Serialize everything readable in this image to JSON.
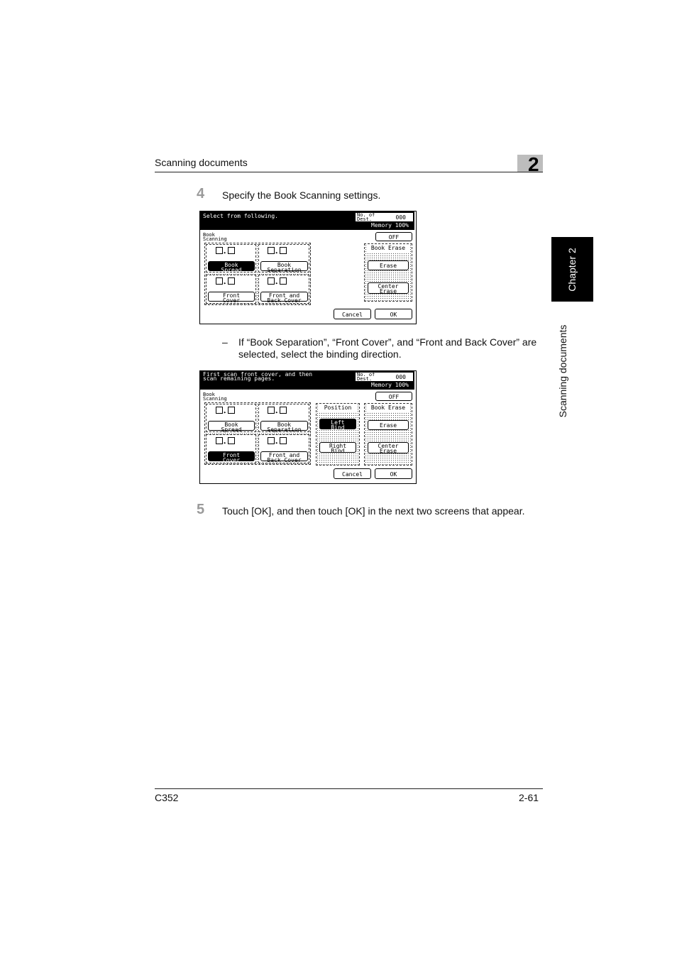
{
  "header": {
    "title": "Scanning documents",
    "chapter_number": "2"
  },
  "side_tab": {
    "chapter": "Chapter 2",
    "section": "Scanning documents"
  },
  "steps": [
    {
      "number": "4",
      "text": "Specify the Book Scanning settings."
    },
    {
      "number": "5",
      "text": "Touch [OK], and then touch [OK] in the next two screens that appear."
    }
  ],
  "substep": {
    "dash": "–",
    "text": "If “Book Separation”, “Front Cover”, and “Front and Back Cover” are selected, select the binding direction."
  },
  "screen1": {
    "message": "Select from following.",
    "dest_label": "No. of\nDest.",
    "dest_value": "000",
    "memory": "Memory 100%",
    "book_scanning_label": "Book\nScanning",
    "options": {
      "book_spread": "Book\nSpread",
      "book_separation": "Book\nSeparation",
      "front_cover": "Front\nCover",
      "front_back_cover": "Front and\nBack Cover"
    },
    "off": "OFF",
    "book_erase_title": "Book Erase",
    "erase": "Erase",
    "center_erase": "Center\nErase",
    "cancel": "Cancel",
    "ok": "OK"
  },
  "screen2": {
    "message": "First scan front cover, and then\nscan remaining pages.",
    "dest_label": "No. of\nDest.",
    "dest_value": "000",
    "memory": "Memory 100%",
    "book_scanning_label": "Book\nScanning",
    "options": {
      "book_spread": "Book\nSpread",
      "book_separation": "Book\nSeparation",
      "front_cover": "Front\nCover",
      "front_back_cover": "Front and\nBack Cover"
    },
    "position_title": "Position",
    "left_bind": "Left\nBind",
    "right_bind": "Right\nBind",
    "off": "OFF",
    "book_erase_title": "Book Erase",
    "erase": "Erase",
    "center_erase": "Center\nErase",
    "cancel": "Cancel",
    "ok": "OK"
  },
  "footer": {
    "model": "C352",
    "page": "2-61"
  },
  "colors": {
    "accent_gray": "#bdbdbd",
    "tab_black": "#000000",
    "step_number_gray": "#9a9a9a"
  }
}
